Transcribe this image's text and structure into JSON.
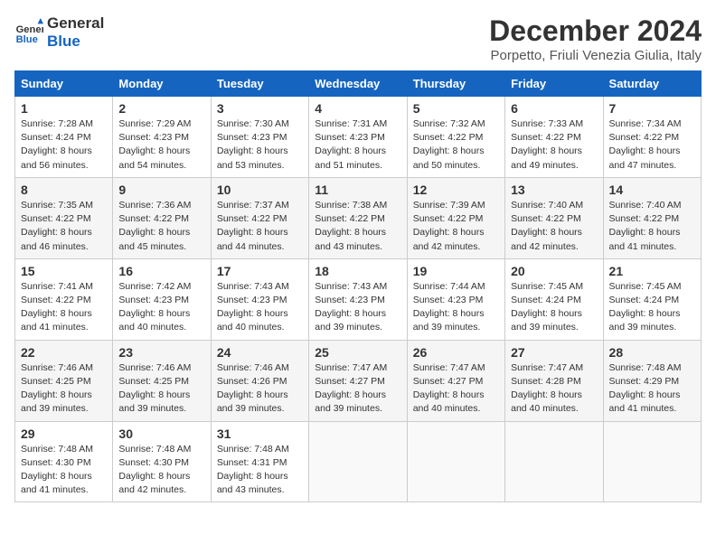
{
  "header": {
    "logo_line1": "General",
    "logo_line2": "Blue",
    "main_title": "December 2024",
    "subtitle": "Porpetto, Friuli Venezia Giulia, Italy"
  },
  "calendar": {
    "weekdays": [
      "Sunday",
      "Monday",
      "Tuesday",
      "Wednesday",
      "Thursday",
      "Friday",
      "Saturday"
    ],
    "weeks": [
      [
        {
          "day": "1",
          "sunrise": "7:28 AM",
          "sunset": "4:24 PM",
          "daylight": "8 hours and 56 minutes."
        },
        {
          "day": "2",
          "sunrise": "7:29 AM",
          "sunset": "4:23 PM",
          "daylight": "8 hours and 54 minutes."
        },
        {
          "day": "3",
          "sunrise": "7:30 AM",
          "sunset": "4:23 PM",
          "daylight": "8 hours and 53 minutes."
        },
        {
          "day": "4",
          "sunrise": "7:31 AM",
          "sunset": "4:23 PM",
          "daylight": "8 hours and 51 minutes."
        },
        {
          "day": "5",
          "sunrise": "7:32 AM",
          "sunset": "4:22 PM",
          "daylight": "8 hours and 50 minutes."
        },
        {
          "day": "6",
          "sunrise": "7:33 AM",
          "sunset": "4:22 PM",
          "daylight": "8 hours and 49 minutes."
        },
        {
          "day": "7",
          "sunrise": "7:34 AM",
          "sunset": "4:22 PM",
          "daylight": "8 hours and 47 minutes."
        }
      ],
      [
        {
          "day": "8",
          "sunrise": "7:35 AM",
          "sunset": "4:22 PM",
          "daylight": "8 hours and 46 minutes."
        },
        {
          "day": "9",
          "sunrise": "7:36 AM",
          "sunset": "4:22 PM",
          "daylight": "8 hours and 45 minutes."
        },
        {
          "day": "10",
          "sunrise": "7:37 AM",
          "sunset": "4:22 PM",
          "daylight": "8 hours and 44 minutes."
        },
        {
          "day": "11",
          "sunrise": "7:38 AM",
          "sunset": "4:22 PM",
          "daylight": "8 hours and 43 minutes."
        },
        {
          "day": "12",
          "sunrise": "7:39 AM",
          "sunset": "4:22 PM",
          "daylight": "8 hours and 42 minutes."
        },
        {
          "day": "13",
          "sunrise": "7:40 AM",
          "sunset": "4:22 PM",
          "daylight": "8 hours and 42 minutes."
        },
        {
          "day": "14",
          "sunrise": "7:40 AM",
          "sunset": "4:22 PM",
          "daylight": "8 hours and 41 minutes."
        }
      ],
      [
        {
          "day": "15",
          "sunrise": "7:41 AM",
          "sunset": "4:22 PM",
          "daylight": "8 hours and 41 minutes."
        },
        {
          "day": "16",
          "sunrise": "7:42 AM",
          "sunset": "4:23 PM",
          "daylight": "8 hours and 40 minutes."
        },
        {
          "day": "17",
          "sunrise": "7:43 AM",
          "sunset": "4:23 PM",
          "daylight": "8 hours and 40 minutes."
        },
        {
          "day": "18",
          "sunrise": "7:43 AM",
          "sunset": "4:23 PM",
          "daylight": "8 hours and 39 minutes."
        },
        {
          "day": "19",
          "sunrise": "7:44 AM",
          "sunset": "4:23 PM",
          "daylight": "8 hours and 39 minutes."
        },
        {
          "day": "20",
          "sunrise": "7:45 AM",
          "sunset": "4:24 PM",
          "daylight": "8 hours and 39 minutes."
        },
        {
          "day": "21",
          "sunrise": "7:45 AM",
          "sunset": "4:24 PM",
          "daylight": "8 hours and 39 minutes."
        }
      ],
      [
        {
          "day": "22",
          "sunrise": "7:46 AM",
          "sunset": "4:25 PM",
          "daylight": "8 hours and 39 minutes."
        },
        {
          "day": "23",
          "sunrise": "7:46 AM",
          "sunset": "4:25 PM",
          "daylight": "8 hours and 39 minutes."
        },
        {
          "day": "24",
          "sunrise": "7:46 AM",
          "sunset": "4:26 PM",
          "daylight": "8 hours and 39 minutes."
        },
        {
          "day": "25",
          "sunrise": "7:47 AM",
          "sunset": "4:27 PM",
          "daylight": "8 hours and 39 minutes."
        },
        {
          "day": "26",
          "sunrise": "7:47 AM",
          "sunset": "4:27 PM",
          "daylight": "8 hours and 40 minutes."
        },
        {
          "day": "27",
          "sunrise": "7:47 AM",
          "sunset": "4:28 PM",
          "daylight": "8 hours and 40 minutes."
        },
        {
          "day": "28",
          "sunrise": "7:48 AM",
          "sunset": "4:29 PM",
          "daylight": "8 hours and 41 minutes."
        }
      ],
      [
        {
          "day": "29",
          "sunrise": "7:48 AM",
          "sunset": "4:30 PM",
          "daylight": "8 hours and 41 minutes."
        },
        {
          "day": "30",
          "sunrise": "7:48 AM",
          "sunset": "4:30 PM",
          "daylight": "8 hours and 42 minutes."
        },
        {
          "day": "31",
          "sunrise": "7:48 AM",
          "sunset": "4:31 PM",
          "daylight": "8 hours and 43 minutes."
        },
        null,
        null,
        null,
        null
      ]
    ]
  }
}
